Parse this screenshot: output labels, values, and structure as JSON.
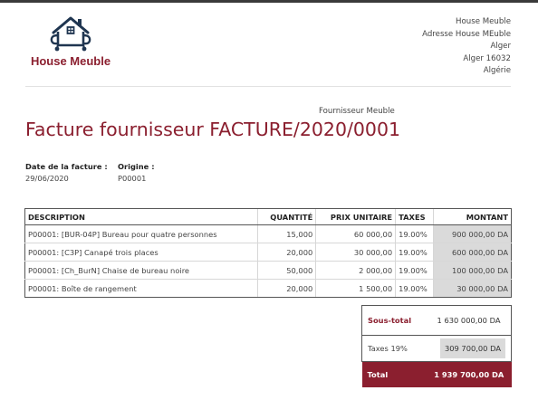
{
  "brand": {
    "name": "House Meuble",
    "accent_color": "#8b1f2f",
    "logo_icon": "house-logo-icon"
  },
  "company": {
    "lines": [
      "House Meuble",
      "Adresse House MEuble",
      "Alger",
      "Alger 16032",
      "Algérie"
    ]
  },
  "supplier": "Fournisseur Meuble",
  "title": "Facture fournisseur FACTURE/2020/0001",
  "info": {
    "date_label": "Date de la facture :",
    "date_value": "29/06/2020",
    "origin_label": "Origine :",
    "origin_value": "P00001"
  },
  "table": {
    "headers": [
      "DESCRIPTION",
      "QUANTITÉ",
      "PRIX UNITAIRE",
      "TAXES",
      "MONTANT"
    ],
    "rows": [
      [
        "P00001: [BUR-04P] Bureau pour quatre personnes",
        "15,000",
        "60 000,00",
        "19.00%",
        "900 000,00 DA"
      ],
      [
        "P00001: [C3P] Canapé trois places",
        "20,000",
        "30 000,00",
        "19.00%",
        "600 000,00 DA"
      ],
      [
        "P00001: [Ch_BurN] Chaise de bureau noire",
        "50,000",
        "2 000,00",
        "19.00%",
        "100 000,00 DA"
      ],
      [
        "P00001: Boîte de rangement",
        "20,000",
        "1 500,00",
        "19.00%",
        "30 000,00 DA"
      ]
    ]
  },
  "totals": {
    "subtotal_label": "Sous-total",
    "subtotal_value": "1 630 000,00 DA",
    "tax_label": "Taxes 19%",
    "tax_value": "309 700,00 DA",
    "total_label": "Total",
    "total_value": "1 939 700,00 DA"
  }
}
